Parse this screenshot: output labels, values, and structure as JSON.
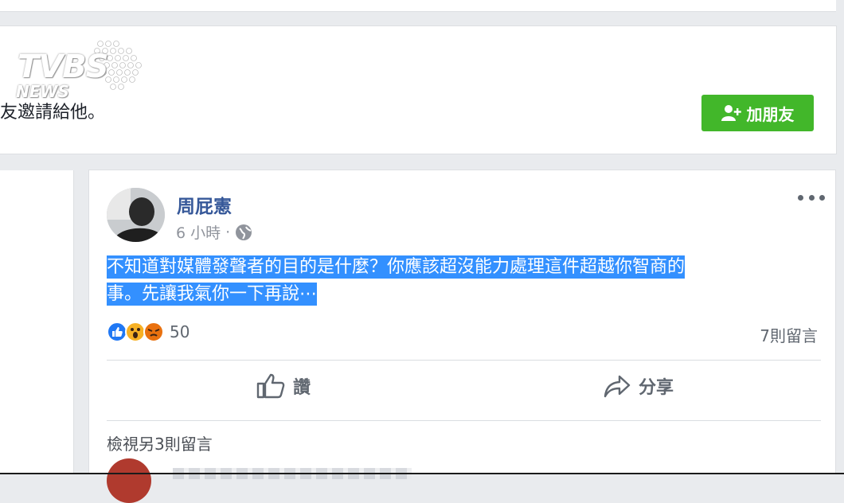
{
  "watermark": {
    "brand": "TVBS",
    "sub": "NEWS"
  },
  "invite": {
    "text": "友邀請給他。",
    "add_friend_label": "加朋友"
  },
  "post": {
    "author": "周屁憲",
    "time": "6 小時",
    "separator": "·",
    "body_line1": "不知道對媒體發聲者的目的是什麼？你應該超沒能力處理這件超越你智商的",
    "body_line2": "事。先讓我氣你一下再說⋯",
    "reaction_count": "50",
    "comment_count": "7則留言",
    "like_label": "讚",
    "share_label": "分享",
    "view_more": "檢視另3則留言"
  },
  "colors": {
    "add_friend_bg": "#42b72a",
    "author": "#365899",
    "highlight": "#3390ff",
    "like_blue": "#2078f4",
    "wow_yellow": "#f7b125",
    "angry_orange": "#e9710f"
  },
  "icons": [
    "add-friend-icon",
    "globe-icon",
    "more-icon",
    "like-reaction-icon",
    "wow-reaction-icon",
    "angry-reaction-icon",
    "thumbs-up-icon",
    "share-arrow-icon"
  ]
}
